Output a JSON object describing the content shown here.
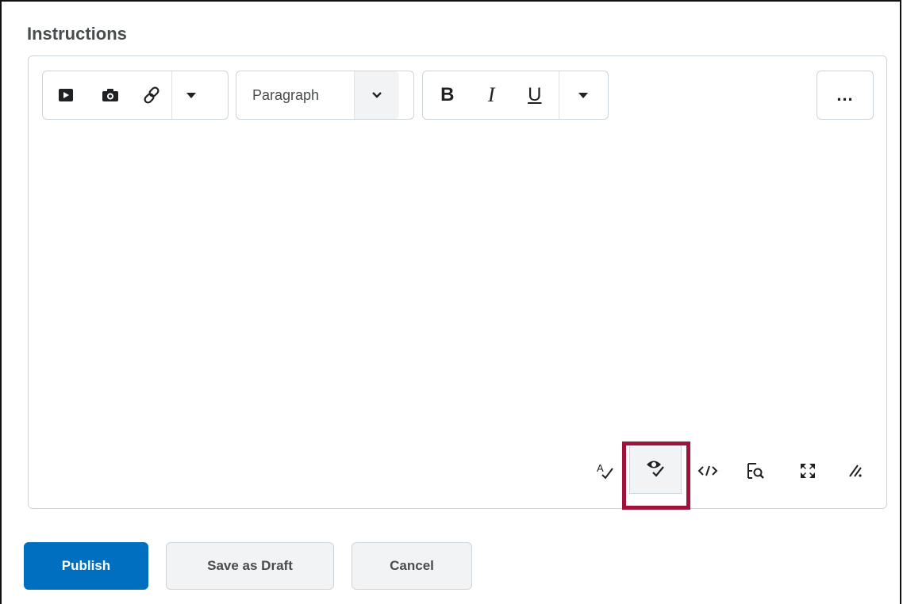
{
  "field": {
    "label": "Instructions"
  },
  "toolbar": {
    "format_select": {
      "value": "Paragraph"
    },
    "bold": "B",
    "italic": "I",
    "underline": "U",
    "more": "..."
  },
  "icons": {
    "insert_stuff": "play-video-icon",
    "insert_image": "camera-icon",
    "insert_link": "link-icon",
    "insert_dropdown": "caret-down-icon",
    "format_dropdown": "chevron-down-icon",
    "style_dropdown": "caret-down-icon",
    "spellcheck": "spellcheck-icon",
    "accessibility_checker": "eye-check-icon",
    "source_code": "code-icon",
    "preview": "find-preview-icon",
    "fullscreen": "fullscreen-icon",
    "resize": "resize-handle-icon"
  },
  "colors": {
    "primary": "#006fbf",
    "highlight": "#a1123a",
    "border": "#cdd5dc"
  },
  "actions": {
    "publish": "Publish",
    "save_draft": "Save as Draft",
    "cancel": "Cancel"
  }
}
